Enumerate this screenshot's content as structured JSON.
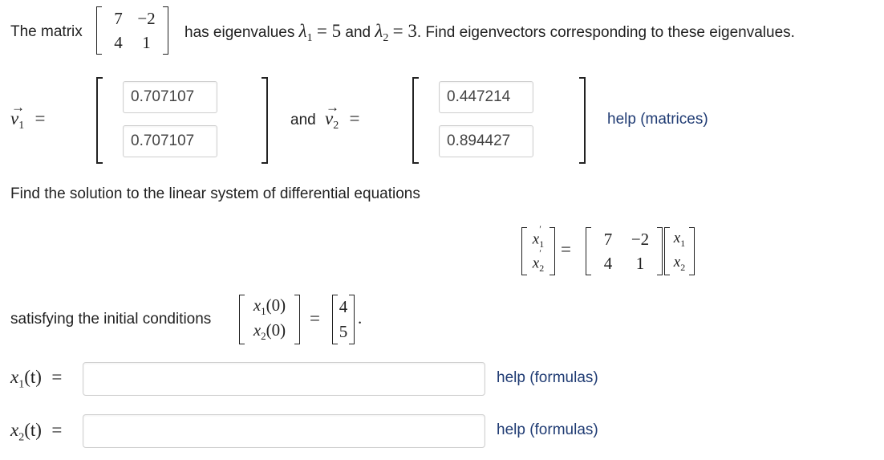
{
  "problem": {
    "intro": "The matrix",
    "matrix_A": [
      [
        "7",
        "−2"
      ],
      [
        "4",
        "1"
      ]
    ],
    "eigen_text_1": "has eigenvalues",
    "lambda1_sym": "λ",
    "lambda1_sub": "1",
    "lambda1_val": "= 5",
    "eigen_and": "and",
    "lambda2_sym": "λ",
    "lambda2_sub": "2",
    "lambda2_val": "= 3",
    "eigen_text_2": ". Find eigenvectors corresponding to these eigenvalues."
  },
  "eigenvectors": {
    "v1_label": "v",
    "v1_sub": "1",
    "equals": "=",
    "v1_values": [
      "0.707107",
      "0.707107"
    ],
    "and_label": "and",
    "v2_label": "v",
    "v2_sub": "2",
    "v2_values": [
      "0.447214",
      "0.894427"
    ],
    "help_link": "help (matrices)"
  },
  "system": {
    "prompt": "Find the solution to the linear system of differential equations",
    "lhs": [
      [
        "x",
        "1",
        "′"
      ],
      [
        "x",
        "2",
        "′"
      ]
    ],
    "matrix": [
      [
        "7",
        "−2"
      ],
      [
        "4",
        "1"
      ]
    ],
    "rhs": [
      [
        "x",
        "1"
      ],
      [
        "x",
        "2"
      ]
    ]
  },
  "initial": {
    "prompt": "satisfying the initial conditions",
    "lhs": [
      [
        "x",
        "1",
        "(0)"
      ],
      [
        "x",
        "2",
        "(0)"
      ]
    ],
    "values": [
      "4",
      "5"
    ],
    "period": "."
  },
  "answers": [
    {
      "var": "x",
      "sub": "1",
      "arg": "(t)",
      "eq": "=",
      "value": "",
      "help_link": "help (formulas)"
    },
    {
      "var": "x",
      "sub": "2",
      "arg": "(t)",
      "eq": "=",
      "value": "",
      "help_link": "help (formulas)"
    }
  ]
}
